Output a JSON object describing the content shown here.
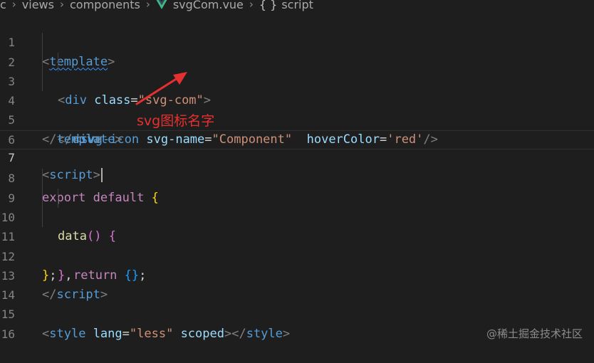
{
  "breadcrumb": {
    "items": [
      "c",
      "views",
      "components",
      "svgCom.vue",
      "script"
    ],
    "icon_file": "vue-logo-icon",
    "icon_symbol": "symbol-braces-icon"
  },
  "code": {
    "line_numbers": [
      "1",
      "2",
      "3",
      "4",
      "5",
      "6",
      "7",
      "8",
      "9",
      "10",
      "11",
      "12",
      "13",
      "14",
      "15",
      "16"
    ],
    "l1": {
      "tag": "template"
    },
    "l2": {
      "tag": "div",
      "attr": "class",
      "value": "\"svg-com\""
    },
    "l3": {
      "tag": "svg-icon",
      "attr1": "svg-name",
      "value1": "\"Component\"",
      "attr2": "hoverColor",
      "value2": "'red'"
    },
    "l4": {
      "tag": "div"
    },
    "l5": {
      "tag": "template"
    },
    "l7": {
      "tag": "script"
    },
    "l8": {
      "kw1": "export",
      "kw2": "default",
      "brace": "{"
    },
    "l9": {
      "fn": "data",
      "paren": "()",
      "brace": "{"
    },
    "l10": {
      "kw": "return",
      "braces": "{}",
      "semi": ";"
    },
    "l11": {
      "brace": "}",
      "comma": ","
    },
    "l12": {
      "brace": "}",
      "semi": ";"
    },
    "l13": {
      "tag": "script"
    },
    "l15": {
      "tag": "style",
      "attr1": "lang",
      "value1": "\"less\"",
      "attr2": "scoped",
      "close_tag": "style"
    }
  },
  "annotation": {
    "text": "svg图标名字",
    "color": "#e63030"
  },
  "watermark": "@稀土掘金技术社区",
  "colors": {
    "background": "#1e1e1e",
    "tag": "#569cd6",
    "attribute": "#9cdcfe",
    "string": "#ce9178",
    "keyword": "#c586c0"
  }
}
